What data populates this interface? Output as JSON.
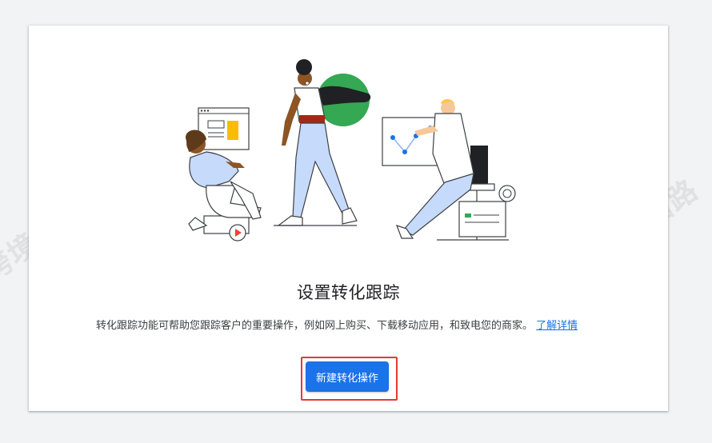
{
  "card": {
    "title": "设置转化跟踪",
    "description": "转化跟踪功能可帮助您跟踪客户的重要操作，例如网上购买、下载移动应用，和致电您的商家。",
    "learn_more": "了解详情",
    "cta_label": "新建转化操作"
  },
  "watermark": {
    "text": "跨境出海陆路"
  },
  "colors": {
    "primary": "#1a73e8",
    "highlight_border": "#e53935",
    "illustration_green": "#34a853",
    "illustration_yellow": "#fbbc04",
    "illustration_red": "#ea4335",
    "illustration_light_blue": "#c6dafc"
  }
}
